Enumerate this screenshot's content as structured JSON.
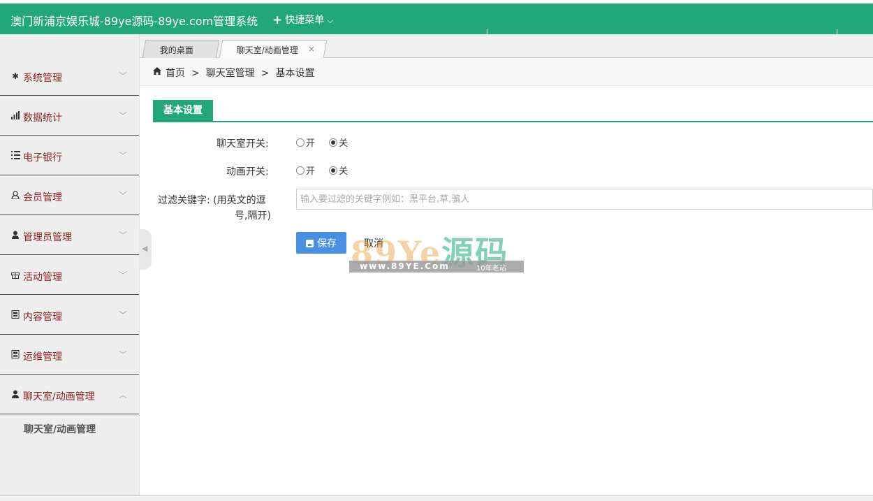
{
  "header": {
    "title": "澳门新浦京娱乐城-89ye源码-89ye.com管理系统",
    "quick_menu_label": "快捷菜单"
  },
  "sidebar": {
    "items": [
      {
        "label": "系统管理",
        "icon": "gear-icon"
      },
      {
        "label": "数据统计",
        "icon": "bar-chart-icon"
      },
      {
        "label": "电子银行",
        "icon": "list-icon"
      },
      {
        "label": "会员管理",
        "icon": "user-outline-icon"
      },
      {
        "label": "管理员管理",
        "icon": "user-icon"
      },
      {
        "label": "活动管理",
        "icon": "gift-icon"
      },
      {
        "label": "内容管理",
        "icon": "document-icon"
      },
      {
        "label": "运维管理",
        "icon": "document-icon"
      },
      {
        "label": "聊天室/动画管理",
        "icon": "user-icon",
        "expanded": true
      }
    ],
    "submenu": {
      "label": "聊天室/动画管理"
    }
  },
  "tabs": [
    {
      "label": "我的桌面"
    },
    {
      "label": "聊天室/动画管理",
      "active": true,
      "close": "×"
    }
  ],
  "breadcrumb": {
    "home": "首页",
    "sep": ">",
    "level1": "聊天室管理",
    "level2": "基本设置"
  },
  "form": {
    "section_title": "基本设置",
    "chat_switch": {
      "label": "聊天室开关:",
      "on": "开",
      "off": "关",
      "value": "关"
    },
    "anim_switch": {
      "label": "动画开关:",
      "on": "开",
      "off": "关",
      "value": "关"
    },
    "keyword": {
      "label_line1": "过滤关键字:  (用英文的逗",
      "label_line2": "号,隔开)",
      "placeholder": "输入要过滤的关键字例如：黑平台,草,骗人",
      "value": ""
    },
    "save_label": "保存",
    "cancel_label": "取消"
  },
  "watermark": {
    "text_ascii": "89Ye",
    "text_han": "源码",
    "url": "www.89YE.Com",
    "tag": "10年老站"
  },
  "colors": {
    "brand_green": "#21a77a",
    "save_blue": "#4a90e2",
    "menu_label": "#8a1f1f"
  }
}
